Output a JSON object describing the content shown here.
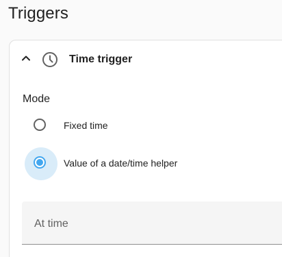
{
  "section": {
    "title": "Triggers"
  },
  "trigger_card": {
    "title": "Time trigger",
    "icons": {
      "collapse": "chevron-up-icon",
      "type": "clock-icon"
    },
    "mode": {
      "label": "Mode",
      "options": [
        {
          "label": "Fixed time",
          "selected": false
        },
        {
          "label": "Value of a date/time helper",
          "selected": true
        }
      ]
    },
    "at_time_field": {
      "label": "At time",
      "value": ""
    }
  },
  "colors": {
    "accent": "#43a7ef",
    "accent_halo": "#d9ecf9",
    "text": "#212121",
    "muted": "#616161"
  }
}
